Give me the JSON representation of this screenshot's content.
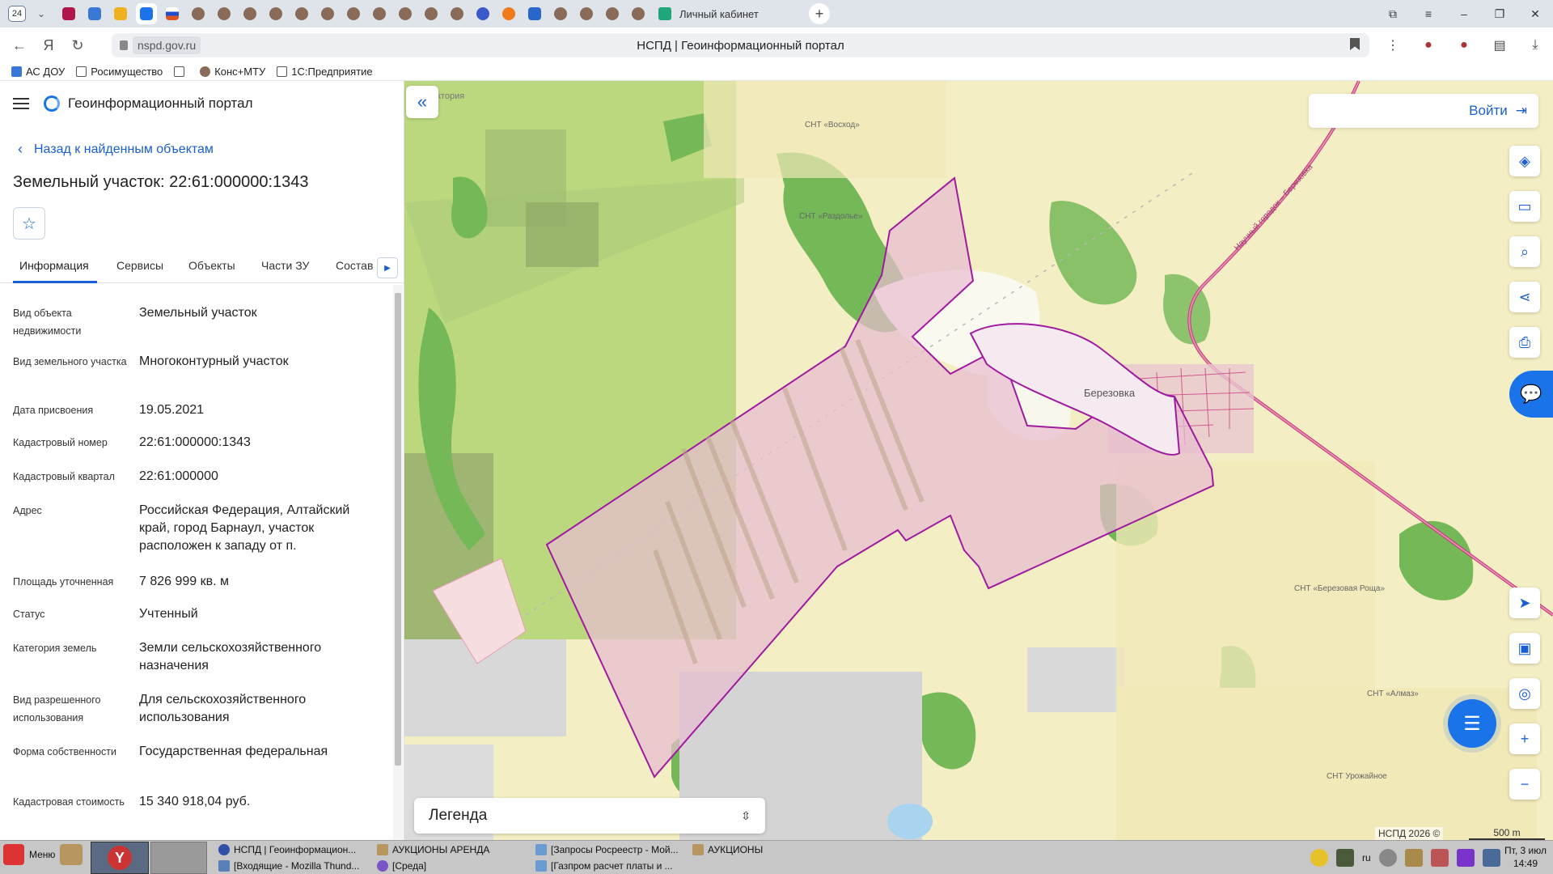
{
  "browser": {
    "tab_count": "24",
    "open_tab_title": "Личный кабинет",
    "page_title": "НСПД | Геоинформационный портал",
    "url_host": "nspd.gov.ru",
    "bookmarks": [
      "АС ДОУ",
      "Росимущество",
      "",
      "Конс+МТУ",
      "1С:Предприятие"
    ]
  },
  "sidebar": {
    "brand": "Геоинформационный портал",
    "back_label": "Назад к найденным объектам",
    "object_title": "Земельный участок: 22:61:000000:1343",
    "tabs": [
      "Информация",
      "Сервисы",
      "Объекты",
      "Части ЗУ",
      "Состав"
    ],
    "properties": [
      {
        "key": "Вид объекта недвижимости",
        "value": "Земельный участок"
      },
      {
        "key": "Вид земельного участка",
        "value": "Многоконтурный участок"
      },
      {
        "key": "Дата присвоения",
        "value": "19.05.2021"
      },
      {
        "key": "Кадастровый номер",
        "value": "22:61:000000:1343"
      },
      {
        "key": "Кадастровый квартал",
        "value": "22:61:000000"
      },
      {
        "key": "Адрес",
        "value": "Российская Федерация, Алтайский край, город Барнаул, участок расположен к западу от п."
      },
      {
        "key": "Площадь уточненная",
        "value": "7 826 999 кв. м"
      },
      {
        "key": "Статус",
        "value": "Учтенный"
      },
      {
        "key": "Категория земель",
        "value": "Земли сельскохозяйственного назначения"
      },
      {
        "key": "Вид разрешенного использования",
        "value": "Для сельскохозяйственного использования"
      },
      {
        "key": "Форма собственности",
        "value": "Государственная федеральная"
      },
      {
        "key": "Кадастровая стоимость",
        "value": "15 340 918,04 руб."
      }
    ]
  },
  "map": {
    "login_label": "Войти",
    "legend_label": "Легенда",
    "copyright": "НСПД 2026 ©",
    "scale_label": "500 m",
    "labels": {
      "village": "Березовка",
      "snt_voskhod": "СНТ «Восход»",
      "snt_razdolye": "СНТ «Раздолье»",
      "snt_berezovaya": "СНТ «Березовая Роща»",
      "snt_almaz": "СНТ «Алмаз»",
      "snt_urozhainoe": "СНТ Урожайное",
      "road": "Научный городок – Березовка",
      "victoria": "ктория"
    },
    "colors": {
      "parcel_stroke": "#a01aa0",
      "parcel_fill": "#e8bcd0",
      "accent": "#1a73e8"
    }
  },
  "taskbar": {
    "menu_label": "Меню",
    "items": [
      "НСПД | Геоинформацион...",
      "[Входящие - Mozilla Thund...",
      "АУКЦИОНЫ АРЕНДА",
      "[Среда]",
      "[Запросы Росреестр - Мой...",
      "[Газпром расчет платы и ...",
      "АУКЦИОНЫ"
    ],
    "lang": "ru",
    "clock_day": "Пт, 3 июл",
    "clock_time": "14:49"
  }
}
